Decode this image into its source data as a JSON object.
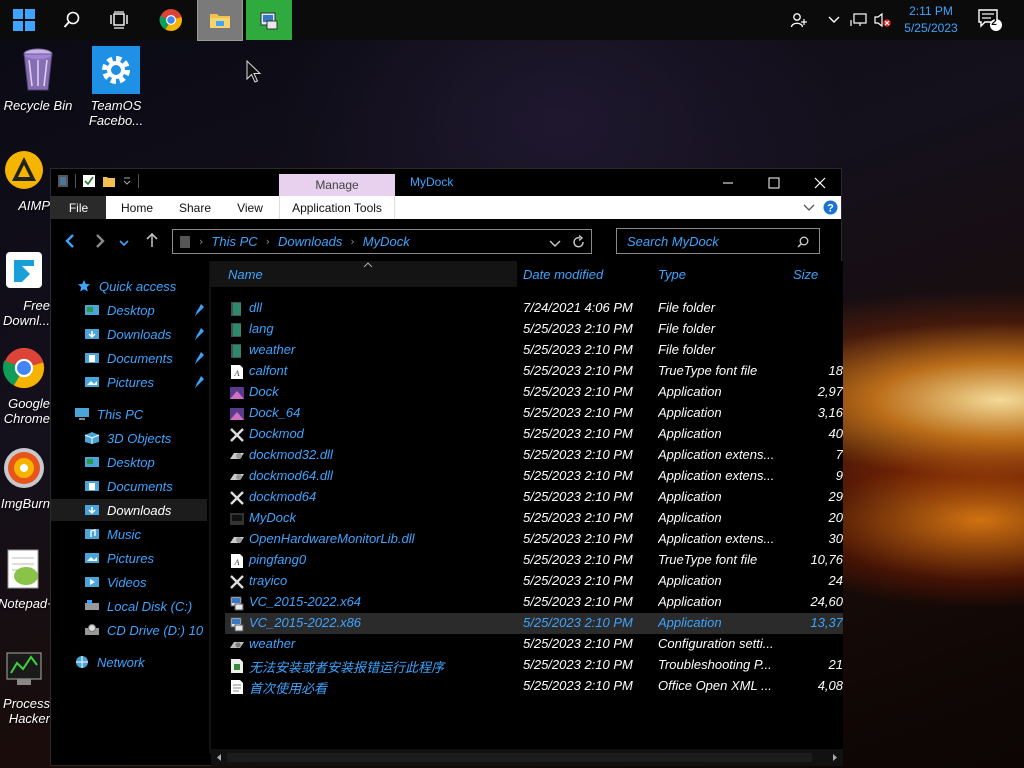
{
  "taskbar": {
    "time": "2:11 PM",
    "date": "5/25/2023",
    "notification_count": "2"
  },
  "desktop": {
    "icons": [
      {
        "label": "Recycle Bin"
      },
      {
        "label": "TeamOS Facebo..."
      },
      {
        "label": "AIMP"
      },
      {
        "label": "Free Downl..."
      },
      {
        "label": "Google Chrome"
      },
      {
        "label": "ImgBurn"
      },
      {
        "label": "Notepad++"
      },
      {
        "label": "Process Hacker"
      }
    ]
  },
  "window": {
    "title": "MyDock",
    "manage_label": "Manage",
    "ribbon_tabs": [
      "File",
      "Home",
      "Share",
      "View",
      "Application Tools"
    ],
    "breadcrumb": [
      "This PC",
      "Downloads",
      "MyDock"
    ],
    "search_placeholder": "Search MyDock",
    "nav": {
      "quick_access": "Quick access",
      "quick_items": [
        "Desktop",
        "Downloads",
        "Documents",
        "Pictures"
      ],
      "this_pc": "This PC",
      "pc_items": [
        "3D Objects",
        "Desktop",
        "Documents",
        "Downloads",
        "Music",
        "Pictures",
        "Videos",
        "Local Disk (C:)",
        "CD Drive (D:) 10 ..."
      ],
      "network": "Network"
    },
    "columns": {
      "name": "Name",
      "date": "Date modified",
      "type": "Type",
      "size": "Size"
    },
    "files": [
      {
        "name": "dll",
        "date": "7/24/2021 4:06 PM",
        "type": "File folder",
        "size": "",
        "icon": "folder-icon"
      },
      {
        "name": "lang",
        "date": "5/25/2023 2:10 PM",
        "type": "File folder",
        "size": "",
        "icon": "folder-icon"
      },
      {
        "name": "weather",
        "date": "5/25/2023 2:10 PM",
        "type": "File folder",
        "size": "",
        "icon": "folder-icon"
      },
      {
        "name": "calfont",
        "date": "5/25/2023 2:10 PM",
        "type": "TrueType font file",
        "size": "18",
        "icon": "font-file-icon"
      },
      {
        "name": "Dock",
        "date": "5/25/2023 2:10 PM",
        "type": "Application",
        "size": "2,97",
        "icon": "dock-app-icon"
      },
      {
        "name": "Dock_64",
        "date": "5/25/2023 2:10 PM",
        "type": "Application",
        "size": "3,16",
        "icon": "dock-app-icon"
      },
      {
        "name": "Dockmod",
        "date": "5/25/2023 2:10 PM",
        "type": "Application",
        "size": "40",
        "icon": "tools-app-icon"
      },
      {
        "name": "dockmod32.dll",
        "date": "5/25/2023 2:10 PM",
        "type": "Application extens...",
        "size": "7",
        "icon": "dll-file-icon"
      },
      {
        "name": "dockmod64.dll",
        "date": "5/25/2023 2:10 PM",
        "type": "Application extens...",
        "size": "9",
        "icon": "dll-file-icon"
      },
      {
        "name": "dockmod64",
        "date": "5/25/2023 2:10 PM",
        "type": "Application",
        "size": "29",
        "icon": "tools-app-icon"
      },
      {
        "name": "MyDock",
        "date": "5/25/2023 2:10 PM",
        "type": "Application",
        "size": "20",
        "icon": "mydock-app-icon"
      },
      {
        "name": "OpenHardwareMonitorLib.dll",
        "date": "5/25/2023 2:10 PM",
        "type": "Application extens...",
        "size": "30",
        "icon": "dll-file-icon"
      },
      {
        "name": "pingfang0",
        "date": "5/25/2023 2:10 PM",
        "type": "TrueType font file",
        "size": "10,76",
        "icon": "font-file-icon"
      },
      {
        "name": "trayico",
        "date": "5/25/2023 2:10 PM",
        "type": "Application",
        "size": "24",
        "icon": "tools-app-icon"
      },
      {
        "name": "VC_2015-2022.x64",
        "date": "5/25/2023 2:10 PM",
        "type": "Application",
        "size": "24,60",
        "icon": "installer-icon"
      },
      {
        "name": "VC_2015-2022.x86",
        "date": "5/25/2023 2:10 PM",
        "type": "Application",
        "size": "13,37",
        "icon": "installer-icon"
      },
      {
        "name": "weather",
        "date": "5/25/2023 2:10 PM",
        "type": "Configuration setti...",
        "size": "",
        "icon": "config-file-icon"
      },
      {
        "name": "无法安装或者安装报错运行此程序",
        "date": "5/25/2023 2:10 PM",
        "type": "Troubleshooting P...",
        "size": "21",
        "icon": "troubleshoot-file-icon"
      },
      {
        "name": "首次使用必看",
        "date": "5/25/2023 2:10 PM",
        "type": "Office Open XML ...",
        "size": "4,08",
        "icon": "document-file-icon"
      }
    ],
    "selected_file_index": 15
  },
  "colors": {
    "accent": "#3da4ff",
    "manage_tab": "#e8d0ef",
    "taskbar_active": "#7a7a7a",
    "taskbar_green": "#2eaa3e"
  }
}
